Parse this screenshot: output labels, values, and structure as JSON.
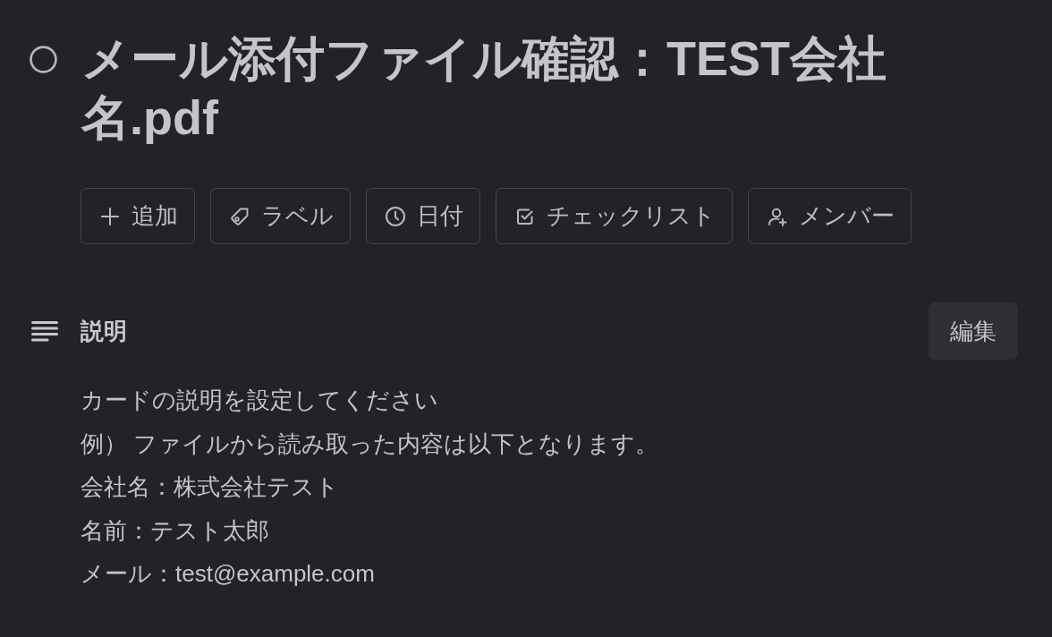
{
  "task": {
    "completed": false,
    "title": "メール添付ファイル確認：TEST会社名.pdf"
  },
  "actions": [
    {
      "kind": "add",
      "label": "追加"
    },
    {
      "kind": "label",
      "label": "ラベル"
    },
    {
      "kind": "date",
      "label": "日付"
    },
    {
      "kind": "checklist",
      "label": "チェックリスト"
    },
    {
      "kind": "members",
      "label": "メンバー"
    }
  ],
  "description": {
    "heading": "説明",
    "edit_button": "編集",
    "lines": [
      "カードの説明を設定してください",
      "例） ファイルから読み取った内容は以下となります。",
      "会社名：株式会社テスト",
      "名前：テスト太郎",
      "メール：test@example.com"
    ]
  }
}
